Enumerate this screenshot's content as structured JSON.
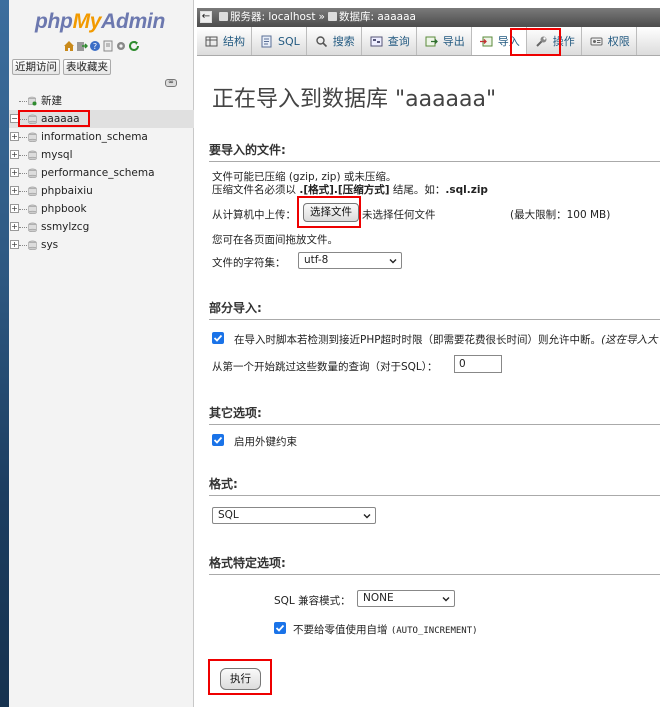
{
  "app": {
    "logo": {
      "php": "php",
      "my": "My",
      "admin": "Admin"
    },
    "nav_icons": [
      "home-icon",
      "exit-icon",
      "help-icon",
      "docs-icon",
      "settings-icon",
      "reload-icon"
    ],
    "nav_links": {
      "recent": "近期访问",
      "favorites": "表收藏夹"
    },
    "link_toggle": "∞"
  },
  "tree": {
    "new": "新建",
    "databases": [
      {
        "name": "aaaaaa",
        "selected": true
      },
      {
        "name": "information_schema"
      },
      {
        "name": "mysql"
      },
      {
        "name": "performance_schema"
      },
      {
        "name": "phpbaixiu"
      },
      {
        "name": "phpbook"
      },
      {
        "name": "ssmylzcg"
      },
      {
        "name": "sys"
      }
    ]
  },
  "breadcrumb": {
    "toggle": "←",
    "server_label": "服务器: localhost",
    "sep": "»",
    "db_label": "数据库: aaaaaa"
  },
  "tabs": [
    {
      "label": "结构",
      "icon": "structure-icon"
    },
    {
      "label": "SQL",
      "icon": "sql-icon"
    },
    {
      "label": "搜索",
      "icon": "search-icon"
    },
    {
      "label": "查询",
      "icon": "query-icon"
    },
    {
      "label": "导出",
      "icon": "export-icon"
    },
    {
      "label": "导入",
      "icon": "import-icon",
      "active": true
    },
    {
      "label": "操作",
      "icon": "wrench-icon"
    },
    {
      "label": "权限",
      "icon": "privileges-icon"
    }
  ],
  "main": {
    "title": "正在导入到数据库 \"aaaaaa\"",
    "file_section": {
      "heading": "要导入的文件:",
      "line1": "文件可能已压缩 (gzip, zip) 或未压缩。",
      "line2_prefix": "压缩文件名必须以 ",
      "line2_format": ".[格式].[压缩方式]",
      "line2_mid": " 结尾。如：",
      "line2_example": ".sql.zip",
      "upload_label": "从计算机中上传：",
      "choose_button": "选择文件",
      "no_file": "未选择任何文件",
      "max_limit": "(最大限制：100 MB)",
      "drag_hint": "您可在各页面间拖放文件。",
      "charset_label": "文件的字符集：",
      "charset_value": "utf-8"
    },
    "partial_section": {
      "heading": "部分导入:",
      "interrupt_text": "在导入时脚本若检测到接近PHP超时时限（即需要花费很长时间）则允许中断。",
      "interrupt_text_italic": "(这在导入大",
      "interrupt_checked": true,
      "skip_label": "从第一个开始跳过这些数量的查询（对于SQL）：",
      "skip_value": "0"
    },
    "other_section": {
      "heading": "其它选项:",
      "fk_label": "启用外键约束",
      "fk_checked": true
    },
    "format_section": {
      "heading": "格式:",
      "format_value": "SQL"
    },
    "format_specific_section": {
      "heading": "格式特定选项:",
      "compat_label": "SQL 兼容模式：",
      "compat_value": "NONE",
      "no_auto_value_label": "不要给零值使用自增",
      "no_auto_value_code": "(AUTO_INCREMENT)",
      "no_auto_value_checked": true
    },
    "go_button": "执行"
  }
}
